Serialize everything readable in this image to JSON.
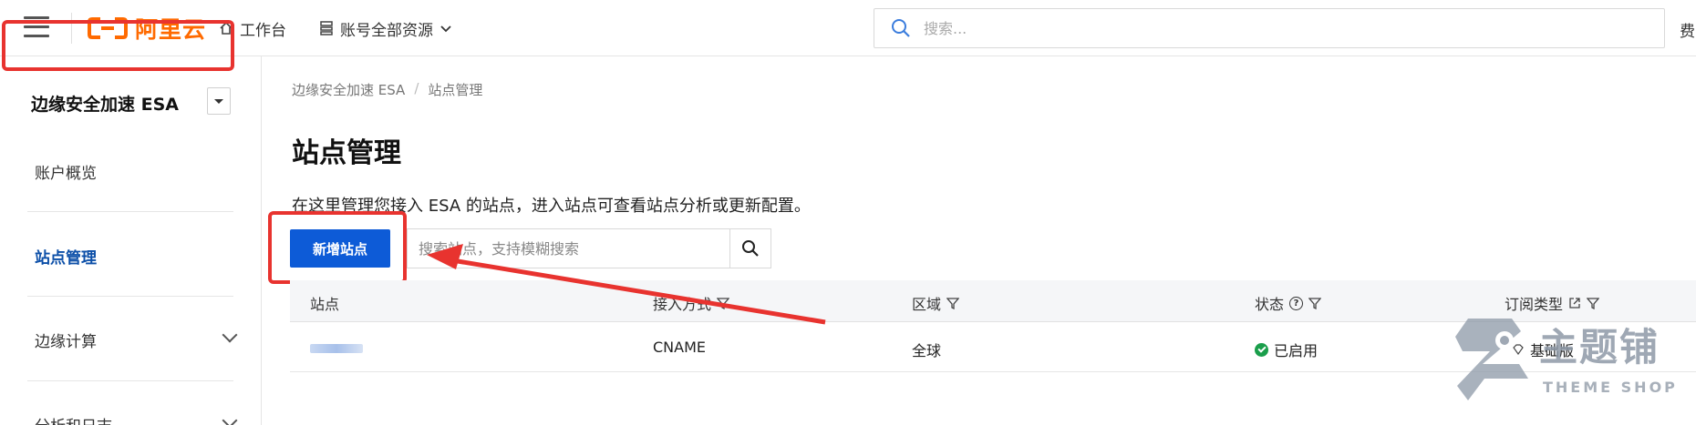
{
  "topbar": {
    "brand": "阿里云",
    "workbench": "工作台",
    "resources": "账号全部资源",
    "search_placeholder": "搜索...",
    "cut_text": "费"
  },
  "sidebar": {
    "product": "边缘安全加速 ESA",
    "items": [
      {
        "label": "账户概览"
      },
      {
        "label": "站点管理"
      },
      {
        "label": "边缘计算"
      },
      {
        "label": "分析和日志"
      }
    ]
  },
  "main": {
    "breadcrumb": [
      "边缘安全加速 ESA",
      "站点管理"
    ],
    "title": "站点管理",
    "description": "在这里管理您接入 ESA 的站点，进入站点可查看站点分析或更新配置。",
    "add_button": "新增站点",
    "search_placeholder": "搜索站点，支持模糊搜索"
  },
  "table": {
    "columns": [
      "站点",
      "接入方式",
      "区域",
      "状态",
      "订阅类型"
    ],
    "rows": [
      {
        "site": "",
        "access": "CNAME",
        "region": "全球",
        "status": "已启用",
        "plan": "基础版"
      }
    ]
  },
  "watermark": {
    "title": "主题铺",
    "subtitle": "THEME SHOP"
  },
  "colors": {
    "brand": "#ff6a00",
    "primary": "#0d5bd7",
    "annotation": "#e8332f",
    "success": "#1a9e4b"
  }
}
